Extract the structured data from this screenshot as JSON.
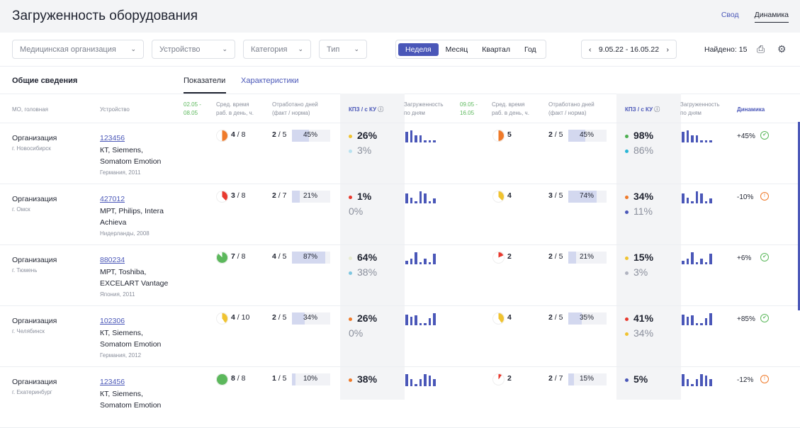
{
  "title": "Загруженность оборудования",
  "view_tabs": [
    "Свод",
    "Динамика"
  ],
  "filters": {
    "org": "Медицинская организация",
    "device": "Устройство",
    "category": "Категория",
    "type": "Тип"
  },
  "periods": [
    "Неделя",
    "Месяц",
    "Квартал",
    "Год"
  ],
  "date_range": "9.05.22 - 16.05.22",
  "found": "Найдено: 15",
  "section": "Общие сведения",
  "tabs": [
    "Показатели",
    "Характеристики"
  ],
  "headers": {
    "mo": "МО, головная",
    "device": "Устройство",
    "p1": "02.05 -\n08.05",
    "avg": "Сред. время\nраб. в день, ч.",
    "worked": "Отработано дней\n(факт / норма)",
    "kpz": "КПЗ / с КУ",
    "load": "Загруженность\nпо дням",
    "p2": "09.05 -\n16.05",
    "dyn": "Динамика"
  },
  "rows": [
    {
      "org": "Организация",
      "city": "г. Новосибирск",
      "id": "123456",
      "name": "КТ, Siemens, Somatom Emotion",
      "origin": "Германия, 2011",
      "a": {
        "pie": 0.5,
        "pc": "#ef7a2a",
        "h": "4",
        "n": "8",
        "f": "2",
        "norm": "5",
        "pct": 45,
        "k1": "26%",
        "k2": "3%",
        "c1": "#f0c330",
        "c2": "#b9e2f0",
        "sp": [
          0.9,
          1,
          0.6,
          0.6,
          0.15,
          0.15,
          0.15
        ]
      },
      "b": {
        "pie": 0.5,
        "pc": "#ef7a2a",
        "h": "5",
        "f": "2",
        "norm": "5",
        "pct": 45,
        "k1": "98%",
        "k2": "86%",
        "c1": "#4caf50",
        "c2": "#29b6d6",
        "sp": [
          0.9,
          1,
          0.6,
          0.6,
          0.15,
          0.15,
          0.15
        ]
      },
      "dyn": "+45%",
      "ok": true
    },
    {
      "org": "Организация",
      "city": "г. Омск",
      "id": "427012",
      "name": "МРТ, Philips, Intera Achieva",
      "origin": "Нидерланды, 2008",
      "a": {
        "pie": 0.38,
        "pc": "#e8392e",
        "h": "3",
        "n": "8",
        "f": "2",
        "norm": "7",
        "pct": 21,
        "k1": "1%",
        "k2": "0%",
        "c1": "#e8392e",
        "c2": "",
        "sp": [
          0.8,
          0.5,
          0.15,
          1,
          0.8,
          0.15,
          0.4
        ]
      },
      "b": {
        "pie": 0.38,
        "pc": "#f0c330",
        "h": "4",
        "f": "3",
        "norm": "5",
        "pct": 74,
        "k1": "34%",
        "k2": "11%",
        "c1": "#ef7a2a",
        "c2": "#4a57b8",
        "sp": [
          0.8,
          0.5,
          0.15,
          1,
          0.8,
          0.15,
          0.4
        ]
      },
      "dyn": "-10%",
      "ok": false
    },
    {
      "org": "Организация",
      "city": "г. Тюмень",
      "id": "880234",
      "name": "МРТ, Toshiba, EXCELART Vantage",
      "origin": "Япония, 2011",
      "a": {
        "pie": 0.88,
        "pc": "#5cb85c",
        "h": "7",
        "n": "8",
        "f": "4",
        "norm": "5",
        "pct": 87,
        "k1": "64%",
        "k2": "38%",
        "c1": "#e8ecd0",
        "c2": "#7fc6e0",
        "sp": [
          0.3,
          0.5,
          1,
          0.15,
          0.5,
          0.15,
          0.9
        ]
      },
      "b": {
        "pie": 0.18,
        "pc": "#e8392e",
        "h": "2",
        "f": "2",
        "norm": "5",
        "pct": 21,
        "k1": "15%",
        "k2": "3%",
        "c1": "#f0c330",
        "c2": "#b0b3c0",
        "sp": [
          0.3,
          0.5,
          1,
          0.15,
          0.5,
          0.15,
          0.9
        ]
      },
      "dyn": "+6%",
      "ok": true
    },
    {
      "org": "Организация",
      "city": "г. Челябинск",
      "id": "102306",
      "name": "КТ, Siemens, Somatom Emotion",
      "origin": "Германия, 2012",
      "a": {
        "pie": 0.4,
        "pc": "#f0c330",
        "h": "4",
        "n": "10",
        "f": "2",
        "norm": "5",
        "pct": 34,
        "k1": "26%",
        "k2": "0%",
        "c1": "#ef7a2a",
        "c2": "",
        "sp": [
          0.9,
          0.7,
          0.8,
          0.15,
          0.15,
          0.6,
          1
        ]
      },
      "b": {
        "pie": 0.4,
        "pc": "#f0c330",
        "h": "4",
        "f": "2",
        "norm": "5",
        "pct": 35,
        "k1": "41%",
        "k2": "34%",
        "c1": "#e8392e",
        "c2": "#f0c330",
        "sp": [
          0.9,
          0.7,
          0.8,
          0.15,
          0.15,
          0.6,
          1
        ]
      },
      "dyn": "+85%",
      "ok": true
    },
    {
      "org": "Организация",
      "city": "г. Екатеринбург",
      "id": "123456",
      "name": "КТ, Siemens, Somatom Emotion",
      "origin": "",
      "a": {
        "pie": 1,
        "pc": "#5cb85c",
        "h": "8",
        "n": "8",
        "f": "1",
        "norm": "5",
        "pct": 10,
        "k1": "38%",
        "k2": "",
        "c1": "#ef7a2a",
        "c2": "",
        "sp": [
          1,
          0.6,
          0.2,
          0.6,
          1,
          0.9,
          0.6
        ]
      },
      "b": {
        "pie": 0.1,
        "pc": "#e8392e",
        "h": "2",
        "f": "2",
        "norm": "7",
        "pct": 15,
        "k1": "5%",
        "k2": "",
        "c1": "#4a57b8",
        "c2": "",
        "sp": [
          1,
          0.6,
          0.2,
          0.6,
          1,
          0.9,
          0.6
        ]
      },
      "dyn": "-12%",
      "ok": false
    }
  ]
}
